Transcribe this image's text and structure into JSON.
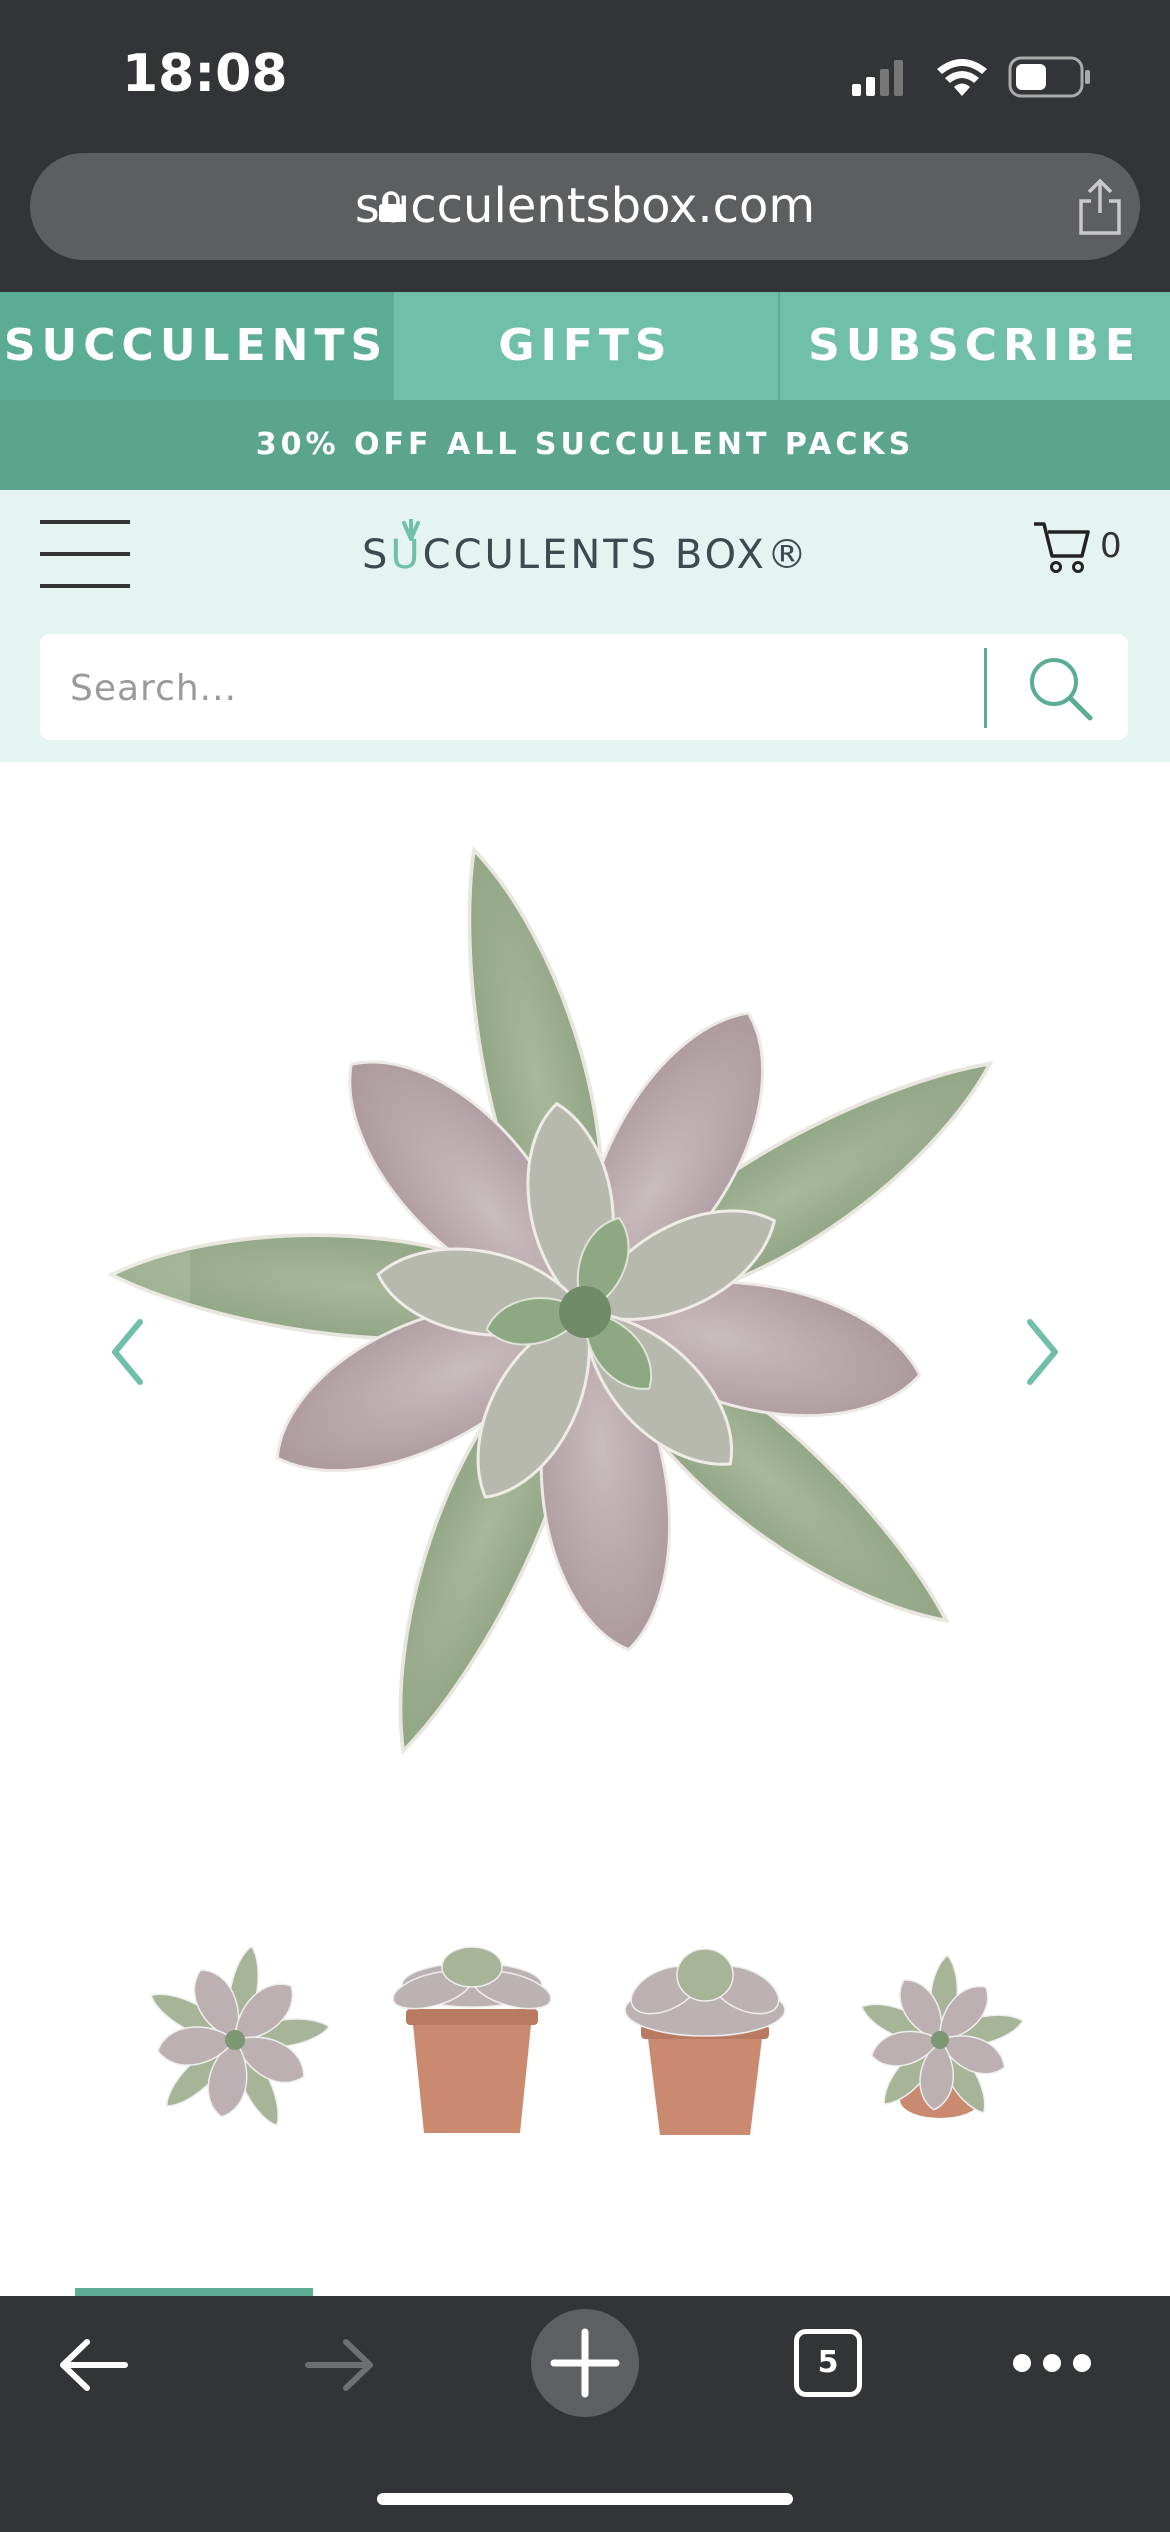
{
  "status_bar": {
    "time": "18:08"
  },
  "browser": {
    "url": "succulentsbox.com"
  },
  "nav": {
    "tabs": [
      "SUCCULENTS",
      "GIFTS",
      "SUBSCRIBE"
    ]
  },
  "promo": {
    "text": "30% OFF ALL SUCCULENT PACKS"
  },
  "header": {
    "logo_text_before": "S",
    "logo_text_u": "U",
    "logo_text_after": "CCULENTS BOX®",
    "cart_count": "0"
  },
  "search": {
    "placeholder": "Search..."
  },
  "toolbar": {
    "tab_count": "5"
  },
  "colors": {
    "brand": "#70bfa8",
    "brand_dark": "#5aad93",
    "chrome": "#333437"
  },
  "icons": [
    "lock-icon",
    "share-icon",
    "menu-icon",
    "cart-icon",
    "search-icon",
    "chevron-left-icon",
    "chevron-right-icon",
    "back-icon",
    "forward-icon",
    "new-tab-icon",
    "tabs-icon",
    "more-icon"
  ]
}
